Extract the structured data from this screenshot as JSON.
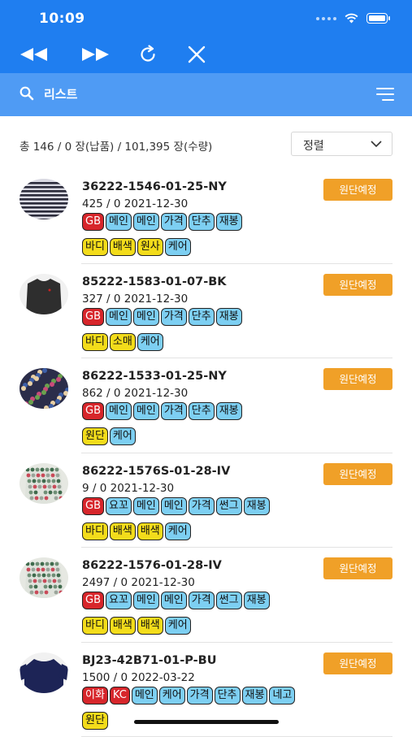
{
  "status_bar": {
    "time": "10:09"
  },
  "colors": {
    "primary": "#1f7ef0",
    "search_bar": "#4f9bf4",
    "status_button": "#f0a028",
    "tag_blue": "#7dcff2",
    "tag_red": "#d7262b",
    "tag_yellow": "#f3dc1b"
  },
  "toolbar": {
    "icons": [
      "rewind-icon",
      "fast-forward-icon",
      "refresh-icon",
      "close-icon"
    ]
  },
  "search": {
    "label": "리스트"
  },
  "summary": {
    "text": "총 146 / 0 장(납품) / 101,395 장(수량)"
  },
  "sort": {
    "selected": "정렬"
  },
  "items": [
    {
      "code": "36222-1546-01-25-NY",
      "meta": "425 / 0 2021-12-30",
      "status": "원단예정",
      "tags1": [
        {
          "t": "GB",
          "c": "red"
        },
        {
          "t": "메인",
          "c": "blue"
        },
        {
          "t": "메인",
          "c": "blue"
        },
        {
          "t": "가격",
          "c": "blue"
        },
        {
          "t": "단추",
          "c": "blue"
        },
        {
          "t": "재봉",
          "c": "blue"
        }
      ],
      "tags2": [
        {
          "t": "바디",
          "c": "yellow"
        },
        {
          "t": "배색",
          "c": "yellow"
        },
        {
          "t": "원사",
          "c": "yellow"
        },
        {
          "t": "케어",
          "c": "blue"
        }
      ]
    },
    {
      "code": "85222-1583-01-07-BK",
      "meta": "327 / 0 2021-12-30",
      "status": "원단예정",
      "tags1": [
        {
          "t": "GB",
          "c": "red"
        },
        {
          "t": "메인",
          "c": "blue"
        },
        {
          "t": "메인",
          "c": "blue"
        },
        {
          "t": "가격",
          "c": "blue"
        },
        {
          "t": "단추",
          "c": "blue"
        },
        {
          "t": "재봉",
          "c": "blue"
        }
      ],
      "tags2": [
        {
          "t": "바디",
          "c": "yellow"
        },
        {
          "t": "소매",
          "c": "yellow"
        },
        {
          "t": "케어",
          "c": "blue"
        }
      ]
    },
    {
      "code": "86222-1533-01-25-NY",
      "meta": "862 / 0 2021-12-30",
      "status": "원단예정",
      "tags1": [
        {
          "t": "GB",
          "c": "red"
        },
        {
          "t": "메인",
          "c": "blue"
        },
        {
          "t": "메인",
          "c": "blue"
        },
        {
          "t": "가격",
          "c": "blue"
        },
        {
          "t": "단추",
          "c": "blue"
        },
        {
          "t": "재봉",
          "c": "blue"
        }
      ],
      "tags2": [
        {
          "t": "원단",
          "c": "yellow"
        },
        {
          "t": "케어",
          "c": "blue"
        }
      ]
    },
    {
      "code": "86222-1576S-01-28-IV",
      "meta": "9 / 0 2021-12-30",
      "status": "원단예정",
      "tags1": [
        {
          "t": "GB",
          "c": "red"
        },
        {
          "t": "요꼬",
          "c": "blue"
        },
        {
          "t": "메인",
          "c": "blue"
        },
        {
          "t": "메인",
          "c": "blue"
        },
        {
          "t": "가격",
          "c": "blue"
        },
        {
          "t": "썬그",
          "c": "blue"
        },
        {
          "t": "재봉",
          "c": "blue"
        }
      ],
      "tags2": [
        {
          "t": "바디",
          "c": "yellow"
        },
        {
          "t": "배색",
          "c": "yellow"
        },
        {
          "t": "배색",
          "c": "yellow"
        },
        {
          "t": "케어",
          "c": "blue"
        }
      ]
    },
    {
      "code": "86222-1576-01-28-IV",
      "meta": "2497 / 0 2021-12-30",
      "status": "원단예정",
      "tags1": [
        {
          "t": "GB",
          "c": "red"
        },
        {
          "t": "요꼬",
          "c": "blue"
        },
        {
          "t": "메인",
          "c": "blue"
        },
        {
          "t": "메인",
          "c": "blue"
        },
        {
          "t": "가격",
          "c": "blue"
        },
        {
          "t": "썬그",
          "c": "blue"
        },
        {
          "t": "재봉",
          "c": "blue"
        }
      ],
      "tags2": [
        {
          "t": "바디",
          "c": "yellow"
        },
        {
          "t": "배색",
          "c": "yellow"
        },
        {
          "t": "배색",
          "c": "yellow"
        },
        {
          "t": "케어",
          "c": "blue"
        }
      ]
    },
    {
      "code": "BJ23-42B71-01-P-BU",
      "meta": "1500 / 0 2022-03-22",
      "status": "원단예정",
      "tags1": [
        {
          "t": "이화",
          "c": "red"
        },
        {
          "t": "KC",
          "c": "red"
        },
        {
          "t": "메인",
          "c": "blue"
        },
        {
          "t": "케어",
          "c": "blue"
        },
        {
          "t": "가격",
          "c": "blue"
        },
        {
          "t": "단추",
          "c": "blue"
        },
        {
          "t": "재봉",
          "c": "blue"
        },
        {
          "t": "네고",
          "c": "blue"
        }
      ],
      "tags2": [
        {
          "t": "원단",
          "c": "yellow"
        }
      ]
    }
  ]
}
